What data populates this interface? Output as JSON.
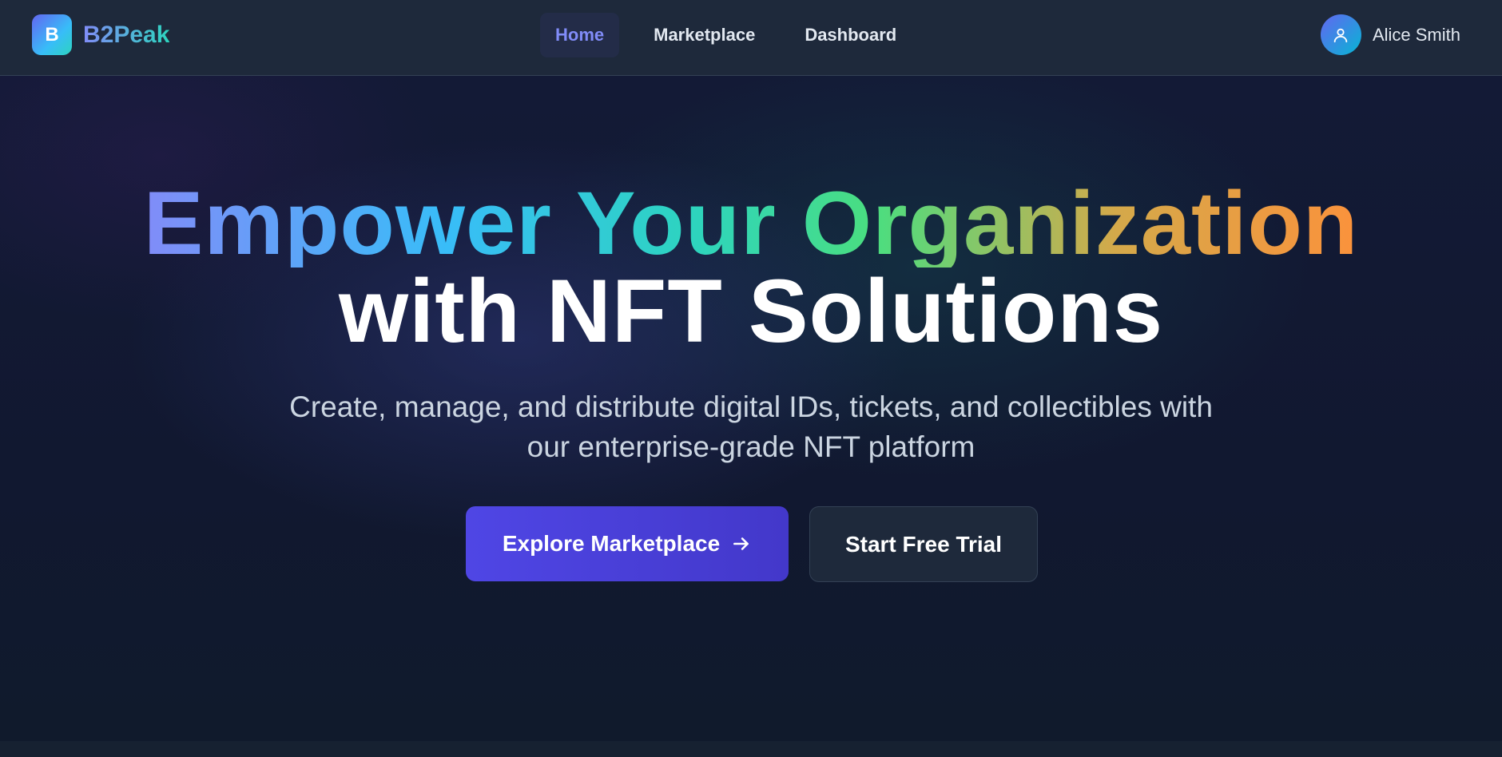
{
  "header": {
    "brand_logo_letter": "B",
    "brand_name": "B2Peak",
    "nav": [
      {
        "label": "Home",
        "active": true
      },
      {
        "label": "Marketplace",
        "active": false
      },
      {
        "label": "Dashboard",
        "active": false
      }
    ],
    "user_name": "Alice Smith",
    "user_icon": "user-icon"
  },
  "hero": {
    "headline_line1": "Empower Your Organization",
    "headline_line2": "with NFT Solutions",
    "subtitle_line1": "Create, manage, and distribute digital IDs, tickets, and collectibles with",
    "subtitle_line2": "our enterprise-grade NFT platform",
    "primary_cta": "Explore Marketplace",
    "primary_cta_icon": "arrow-right-icon",
    "secondary_cta": "Start Free Trial"
  },
  "colors": {
    "accent": "#4f46e5",
    "nav_active": "#818cf8",
    "background": "#0f172a"
  }
}
